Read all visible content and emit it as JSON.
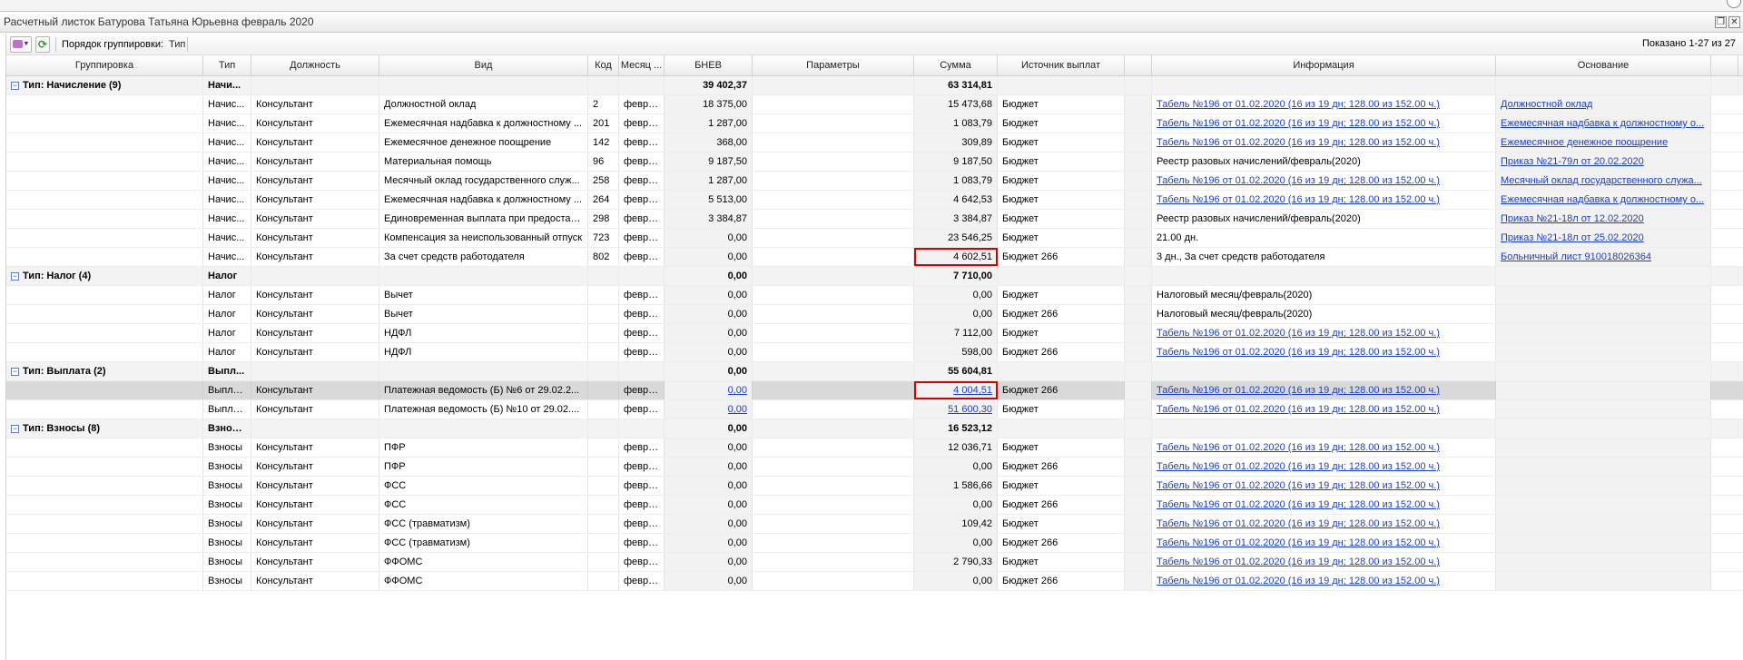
{
  "window": {
    "title": "Расчетный листок Батурова Татьяна Юрьевна февраль 2020",
    "restore_icon": "restore-icon",
    "close_icon": "close-icon"
  },
  "toolbar": {
    "grouping_label": "Порядок группировки:",
    "grouping_value": "Тип",
    "shown": "Показано 1-27 из 27"
  },
  "columns": {
    "grp": "Группировка",
    "type": "Тип",
    "pos": "Должность",
    "kind": "Вид",
    "code": "Код",
    "month": "Месяц ...",
    "bnev": "БНЕВ",
    "params": "Параметры",
    "sum": "Сумма",
    "src": "Источник выплат",
    "info": "Информация",
    "base": "Основание"
  },
  "groups": [
    {
      "label": "Тип: Начисление (9)",
      "type": "Начи...",
      "bnev": "39 402,37",
      "sum": "63 314,81",
      "rows": [
        {
          "type": "Начис...",
          "pos": "Консультант",
          "kind": "Должностной оклад",
          "code": "2",
          "month": "февра...",
          "bnev": "18 375,00",
          "sum": "15 473,68",
          "src": "Бюджет",
          "info": "Табель №196 от 01.02.2020 (16 из 19 дн; 128.00 из 152.00 ч.)",
          "base": "Должностной оклад"
        },
        {
          "type": "Начис...",
          "pos": "Консультант",
          "kind": "Ежемесячная надбавка к должностному ...",
          "code": "201",
          "month": "февра...",
          "bnev": "1 287,00",
          "sum": "1 083,79",
          "src": "Бюджет",
          "info": "Табель №196 от 01.02.2020 (16 из 19 дн; 128.00 из 152.00 ч.)",
          "base": "Ежемесячная надбавка к должностному о..."
        },
        {
          "type": "Начис...",
          "pos": "Консультант",
          "kind": "Ежемесячное денежное поощрение",
          "code": "142",
          "month": "февра...",
          "bnev": "368,00",
          "sum": "309,89",
          "src": "Бюджет",
          "info": "Табель №196 от 01.02.2020 (16 из 19 дн; 128.00 из 152.00 ч.)",
          "base": "Ежемесячное денежное поощрение"
        },
        {
          "type": "Начис...",
          "pos": "Консультант",
          "kind": "Материальная помощь",
          "code": "96",
          "month": "февра...",
          "bnev": "9 187,50",
          "sum": "9 187,50",
          "src": "Бюджет",
          "info": "Реестр разовых начислений/февраль(2020)",
          "base": "Приказ №21-79л от 20.02.2020"
        },
        {
          "type": "Начис...",
          "pos": "Консультант",
          "kind": "Месячный оклад государственного служ...",
          "code": "258",
          "month": "февра...",
          "bnev": "1 287,00",
          "sum": "1 083,79",
          "src": "Бюджет",
          "info": "Табель №196 от 01.02.2020 (16 из 19 дн; 128.00 из 152.00 ч.)",
          "base": "Месячный оклад государственного служа..."
        },
        {
          "type": "Начис...",
          "pos": "Консультант",
          "kind": "Ежемесячная надбавка к должностному ...",
          "code": "264",
          "month": "февра...",
          "bnev": "5 513,00",
          "sum": "4 642,53",
          "src": "Бюджет",
          "info": "Табель №196 от 01.02.2020 (16 из 19 дн; 128.00 из 152.00 ч.)",
          "base": "Ежемесячная надбавка к должностному о..."
        },
        {
          "type": "Начис...",
          "pos": "Консультант",
          "kind": "Единовременная выплата при предостав...",
          "code": "298",
          "month": "февра...",
          "bnev": "3 384,87",
          "sum": "3 384,87",
          "src": "Бюджет",
          "info": "Реестр разовых начислений/февраль(2020)",
          "base": "Приказ №21-18л от 12.02.2020"
        },
        {
          "type": "Начис...",
          "pos": "Консультант",
          "kind": "Компенсация за неиспользованный отпуск",
          "code": "723",
          "month": "февра...",
          "bnev": "0,00",
          "sum": "23 546,25",
          "src": "Бюджет",
          "info": "21.00 дн.",
          "base": "Приказ №21-18л от 25.02.2020"
        },
        {
          "type": "Начис...",
          "pos": "Консультант",
          "kind": "За счет средств работодателя",
          "code": "802",
          "month": "февра...",
          "bnev": "0,00",
          "sum": "4 602,51",
          "src": "Бюджет 266",
          "info": "3 дн., За счет средств работодателя",
          "base": "Больничный лист 910018026364"
        }
      ]
    },
    {
      "label": "Тип: Налог (4)",
      "type": "Налог",
      "bnev": "0,00",
      "sum": "7 710,00",
      "rows": [
        {
          "type": "Налог",
          "pos": "Консультант",
          "kind": "Вычет",
          "code": "",
          "month": "февра...",
          "bnev": "0,00",
          "sum": "0,00",
          "src": "Бюджет",
          "info": "Налоговый месяц/февраль(2020)",
          "base": ""
        },
        {
          "type": "Налог",
          "pos": "Консультант",
          "kind": "Вычет",
          "code": "",
          "month": "февра...",
          "bnev": "0,00",
          "sum": "0,00",
          "src": "Бюджет 266",
          "info": "Налоговый месяц/февраль(2020)",
          "base": ""
        },
        {
          "type": "Налог",
          "pos": "Консультант",
          "kind": "НДФЛ",
          "code": "",
          "month": "февра...",
          "bnev": "0,00",
          "sum": "7 112,00",
          "src": "Бюджет",
          "info": "Табель №196 от 01.02.2020 (16 из 19 дн; 128.00 из 152.00 ч.)",
          "base": ""
        },
        {
          "type": "Налог",
          "pos": "Консультант",
          "kind": "НДФЛ",
          "code": "",
          "month": "февра...",
          "bnev": "0,00",
          "sum": "598,00",
          "src": "Бюджет 266",
          "info": "Табель №196 от 01.02.2020 (16 из 19 дн; 128.00 из 152.00 ч.)",
          "base": ""
        }
      ]
    },
    {
      "label": "Тип: Выплата (2)",
      "type": "Выпл...",
      "bnev": "0,00",
      "sum": "55 604,81",
      "rows": [
        {
          "type": "Выплата",
          "pos": "Консультант",
          "kind": "Платежная ведомость (Б) №6 от 29.02.2...",
          "code": "",
          "month": "февра...",
          "bnev": "0,00",
          "sum": "4 004,51",
          "src": "Бюджет 266",
          "info": "Табель №196 от 01.02.2020 (16 из 19 дн; 128.00 из 152.00 ч.)",
          "base": ""
        },
        {
          "type": "Выплата",
          "pos": "Консультант",
          "kind": "Платежная ведомость (Б) №10 от 29.02....",
          "code": "",
          "month": "февра...",
          "bnev": "0,00",
          "sum": "51 600,30",
          "src": "Бюджет",
          "info": "Табель №196 от 01.02.2020 (16 из 19 дн; 128.00 из 152.00 ч.)",
          "base": ""
        }
      ]
    },
    {
      "label": "Тип: Взносы (8)",
      "type": "Взносы",
      "bnev": "0,00",
      "sum": "16 523,12",
      "rows": [
        {
          "type": "Взносы",
          "pos": "Консультант",
          "kind": "ПФР",
          "code": "",
          "month": "февра...",
          "bnev": "0,00",
          "sum": "12 036,71",
          "src": "Бюджет",
          "info": "Табель №196 от 01.02.2020 (16 из 19 дн; 128.00 из 152.00 ч.)",
          "base": ""
        },
        {
          "type": "Взносы",
          "pos": "Консультант",
          "kind": "ПФР",
          "code": "",
          "month": "февра...",
          "bnev": "0,00",
          "sum": "0,00",
          "src": "Бюджет 266",
          "info": "Табель №196 от 01.02.2020 (16 из 19 дн; 128.00 из 152.00 ч.)",
          "base": ""
        },
        {
          "type": "Взносы",
          "pos": "Консультант",
          "kind": "ФСС",
          "code": "",
          "month": "февра...",
          "bnev": "0,00",
          "sum": "1 586,66",
          "src": "Бюджет",
          "info": "Табель №196 от 01.02.2020 (16 из 19 дн; 128.00 из 152.00 ч.)",
          "base": ""
        },
        {
          "type": "Взносы",
          "pos": "Консультант",
          "kind": "ФСС",
          "code": "",
          "month": "февра...",
          "bnev": "0,00",
          "sum": "0,00",
          "src": "Бюджет 266",
          "info": "Табель №196 от 01.02.2020 (16 из 19 дн; 128.00 из 152.00 ч.)",
          "base": ""
        },
        {
          "type": "Взносы",
          "pos": "Консультант",
          "kind": "ФСС (травматизм)",
          "code": "",
          "month": "февра...",
          "bnev": "0,00",
          "sum": "109,42",
          "src": "Бюджет",
          "info": "Табель №196 от 01.02.2020 (16 из 19 дн; 128.00 из 152.00 ч.)",
          "base": ""
        },
        {
          "type": "Взносы",
          "pos": "Консультант",
          "kind": "ФСС (травматизм)",
          "code": "",
          "month": "февра...",
          "bnev": "0,00",
          "sum": "0,00",
          "src": "Бюджет 266",
          "info": "Табель №196 от 01.02.2020 (16 из 19 дн; 128.00 из 152.00 ч.)",
          "base": ""
        },
        {
          "type": "Взносы",
          "pos": "Консультант",
          "kind": "ФФОМС",
          "code": "",
          "month": "февра...",
          "bnev": "0,00",
          "sum": "2 790,33",
          "src": "Бюджет",
          "info": "Табель №196 от 01.02.2020 (16 из 19 дн; 128.00 из 152.00 ч.)",
          "base": ""
        },
        {
          "type": "Взносы",
          "pos": "Консультант",
          "kind": "ФФОМС",
          "code": "",
          "month": "февра...",
          "bnev": "0,00",
          "sum": "0,00",
          "src": "Бюджет 266",
          "info": "Табель №196 от 01.02.2020 (16 из 19 дн; 128.00 из 152.00 ч.)",
          "base": ""
        }
      ]
    }
  ],
  "colors": {
    "link": "#1a3fc7",
    "highlight": "#d40000",
    "selected_row": "#d9d9d9"
  }
}
